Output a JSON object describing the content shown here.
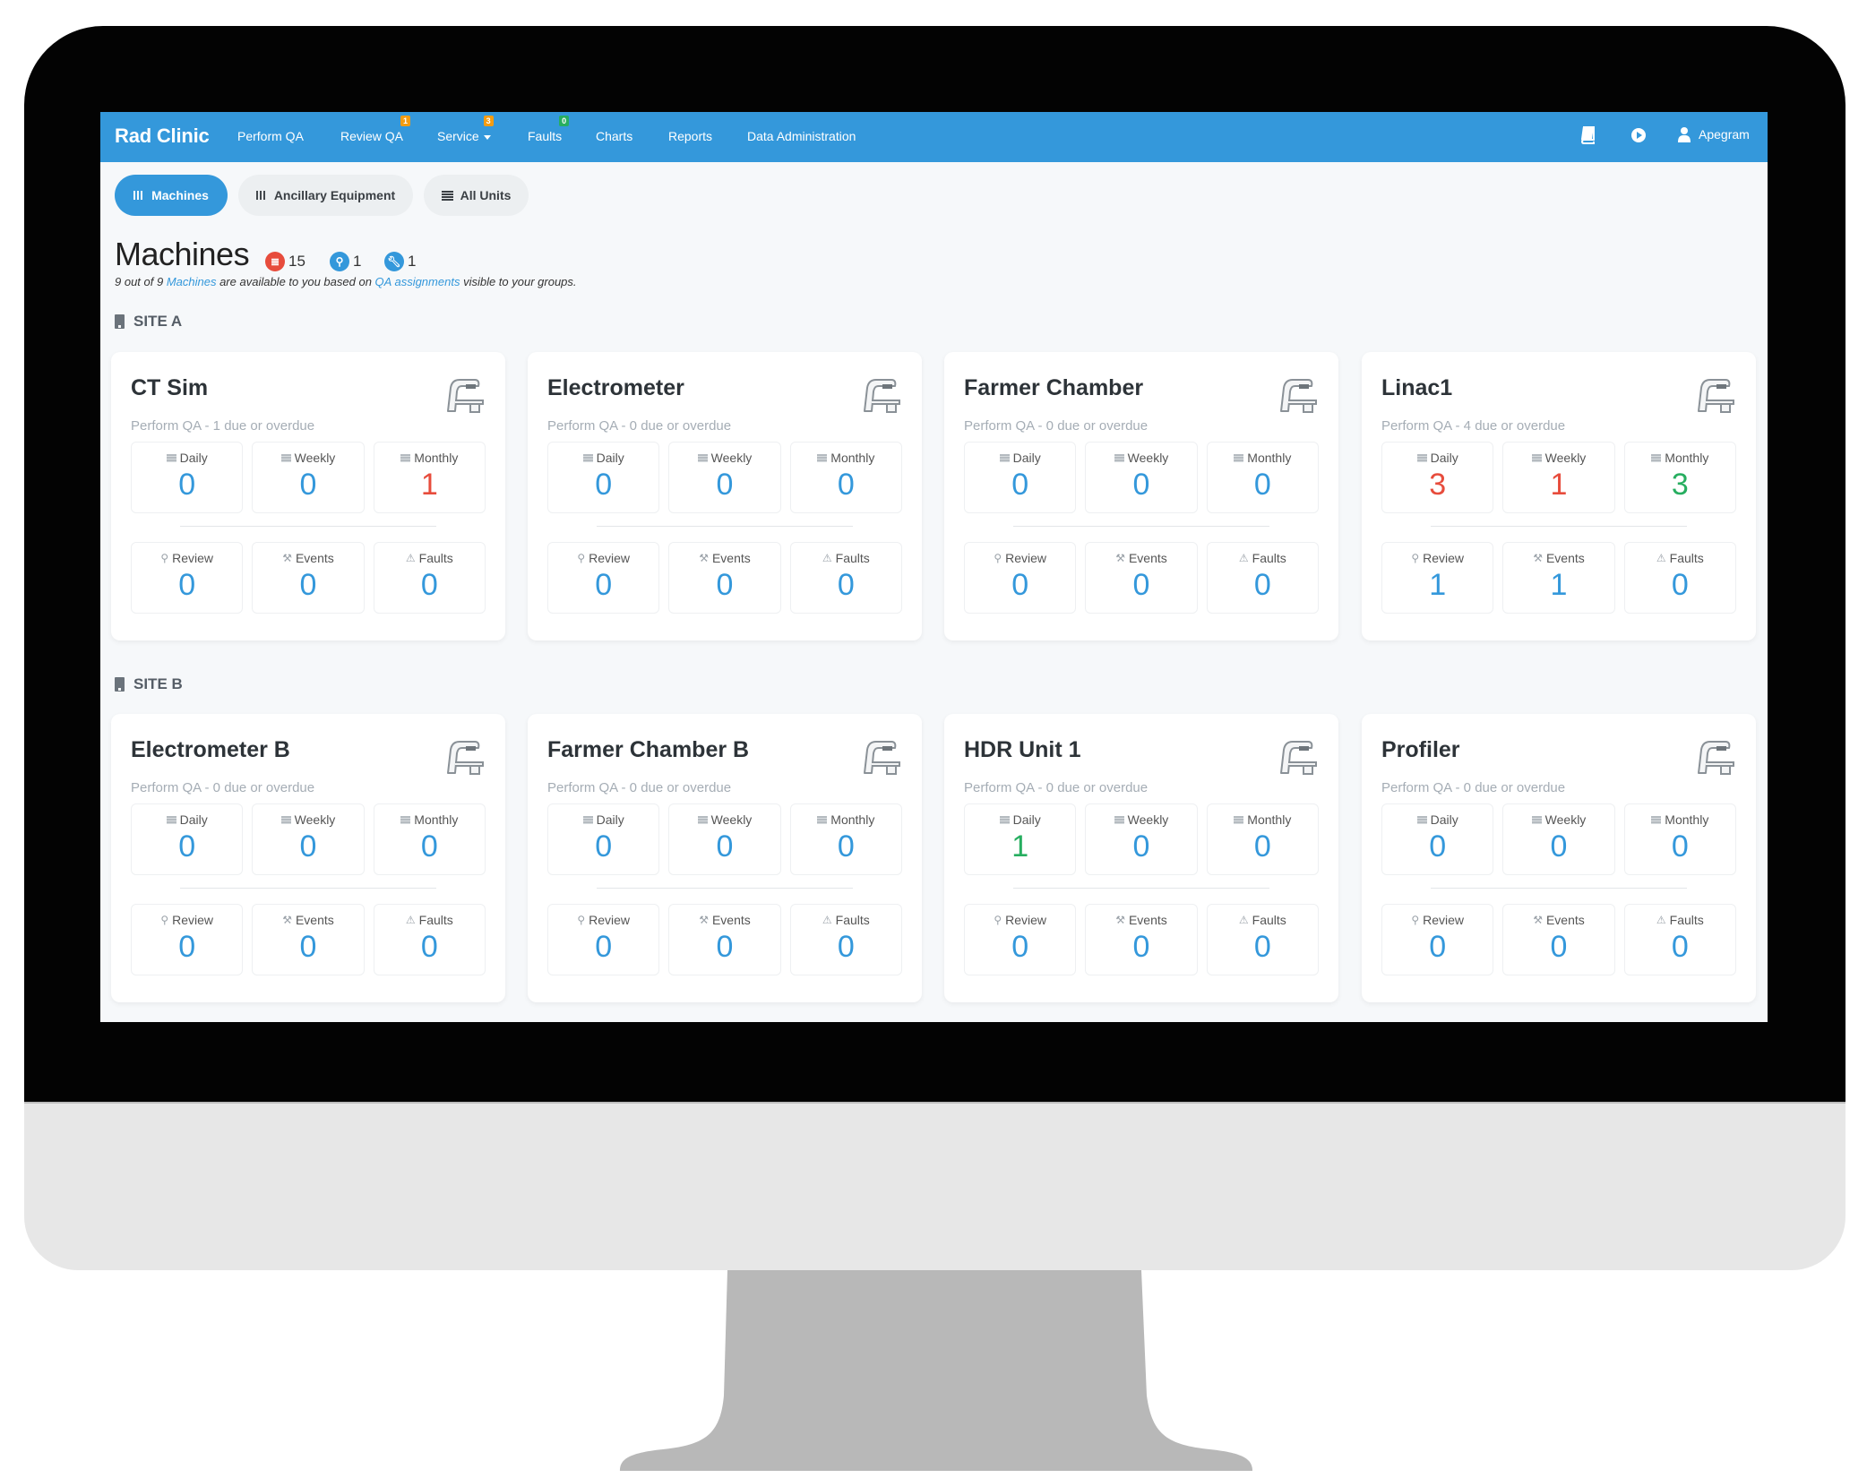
{
  "colors": {
    "primary": "#3498db",
    "danger": "#e74c3c",
    "success": "#27ae60",
    "warning": "#f39c12",
    "badge_green": "#2ecc71"
  },
  "navbar": {
    "brand": "Rad Clinic",
    "items": [
      {
        "label": "Perform QA"
      },
      {
        "label": "Review QA",
        "badge": "1",
        "badge_color": "warning"
      },
      {
        "label": "Service",
        "badge": "3",
        "badge_color": "warning",
        "dropdown": true
      },
      {
        "label": "Faults",
        "badge": "0",
        "badge_color": "success"
      },
      {
        "label": "Charts"
      },
      {
        "label": "Reports"
      },
      {
        "label": "Data Administration"
      }
    ],
    "right": {
      "book_icon": "book-icon",
      "play_icon": "play-circle-icon",
      "user_icon": "user-icon",
      "username": "Apegram"
    }
  },
  "tabs": [
    {
      "label": "Machines",
      "icon": "grid-icon",
      "active": true
    },
    {
      "label": "Ancillary Equipment",
      "icon": "grid-icon",
      "active": false
    },
    {
      "label": "All Units",
      "icon": "list-icon",
      "active": false
    }
  ],
  "header": {
    "title": "Machines",
    "counts": [
      {
        "icon": "qa-list-icon",
        "value": "15",
        "color": "danger"
      },
      {
        "icon": "search-icon",
        "value": "1",
        "color": "primary"
      },
      {
        "icon": "wrench-icon",
        "value": "1",
        "color": "primary"
      }
    ],
    "subtitle": {
      "prefix": "9 out of 9 ",
      "link1": "Machines",
      "middle": " are available to you based on ",
      "link2": "QA assignments",
      "suffix": " visible to your groups."
    }
  },
  "sites": [
    {
      "name": "SITE A",
      "machines": [
        {
          "name": "CT Sim",
          "summary": "Perform QA - 1 due or overdue",
          "qa": [
            {
              "label": "Daily",
              "value": "0",
              "status": "ok"
            },
            {
              "label": "Weekly",
              "value": "0",
              "status": "ok"
            },
            {
              "label": "Monthly",
              "value": "1",
              "status": "overdue"
            }
          ],
          "other": [
            {
              "label": "Review",
              "value": "0"
            },
            {
              "label": "Events",
              "value": "0"
            },
            {
              "label": "Faults",
              "value": "0"
            }
          ]
        },
        {
          "name": "Electrometer",
          "summary": "Perform QA - 0 due or overdue",
          "qa": [
            {
              "label": "Daily",
              "value": "0",
              "status": "ok"
            },
            {
              "label": "Weekly",
              "value": "0",
              "status": "ok"
            },
            {
              "label": "Monthly",
              "value": "0",
              "status": "ok"
            }
          ],
          "other": [
            {
              "label": "Review",
              "value": "0"
            },
            {
              "label": "Events",
              "value": "0"
            },
            {
              "label": "Faults",
              "value": "0"
            }
          ]
        },
        {
          "name": "Farmer Chamber",
          "summary": "Perform QA - 0 due or overdue",
          "qa": [
            {
              "label": "Daily",
              "value": "0",
              "status": "ok"
            },
            {
              "label": "Weekly",
              "value": "0",
              "status": "ok"
            },
            {
              "label": "Monthly",
              "value": "0",
              "status": "ok"
            }
          ],
          "other": [
            {
              "label": "Review",
              "value": "0"
            },
            {
              "label": "Events",
              "value": "0"
            },
            {
              "label": "Faults",
              "value": "0"
            }
          ]
        },
        {
          "name": "Linac1",
          "summary": "Perform QA - 4 due or overdue",
          "qa": [
            {
              "label": "Daily",
              "value": "3",
              "status": "overdue"
            },
            {
              "label": "Weekly",
              "value": "1",
              "status": "overdue"
            },
            {
              "label": "Monthly",
              "value": "3",
              "status": "due"
            }
          ],
          "other": [
            {
              "label": "Review",
              "value": "1"
            },
            {
              "label": "Events",
              "value": "1"
            },
            {
              "label": "Faults",
              "value": "0"
            }
          ]
        }
      ]
    },
    {
      "name": "SITE B",
      "machines": [
        {
          "name": "Electrometer B",
          "summary": "Perform QA - 0 due or overdue",
          "qa": [
            {
              "label": "Daily",
              "value": "0",
              "status": "ok"
            },
            {
              "label": "Weekly",
              "value": "0",
              "status": "ok"
            },
            {
              "label": "Monthly",
              "value": "0",
              "status": "ok"
            }
          ],
          "other": [
            {
              "label": "Review",
              "value": "0"
            },
            {
              "label": "Events",
              "value": "0"
            },
            {
              "label": "Faults",
              "value": "0"
            }
          ]
        },
        {
          "name": "Farmer Chamber B",
          "summary": "Perform QA - 0 due or overdue",
          "qa": [
            {
              "label": "Daily",
              "value": "0",
              "status": "ok"
            },
            {
              "label": "Weekly",
              "value": "0",
              "status": "ok"
            },
            {
              "label": "Monthly",
              "value": "0",
              "status": "ok"
            }
          ],
          "other": [
            {
              "label": "Review",
              "value": "0"
            },
            {
              "label": "Events",
              "value": "0"
            },
            {
              "label": "Faults",
              "value": "0"
            }
          ]
        },
        {
          "name": "HDR Unit 1",
          "summary": "Perform QA - 0 due or overdue",
          "qa": [
            {
              "label": "Daily",
              "value": "1",
              "status": "due"
            },
            {
              "label": "Weekly",
              "value": "0",
              "status": "ok"
            },
            {
              "label": "Monthly",
              "value": "0",
              "status": "ok"
            }
          ],
          "other": [
            {
              "label": "Review",
              "value": "0"
            },
            {
              "label": "Events",
              "value": "0"
            },
            {
              "label": "Faults",
              "value": "0"
            }
          ]
        },
        {
          "name": "Profiler",
          "summary": "Perform QA - 0 due or overdue",
          "qa": [
            {
              "label": "Daily",
              "value": "0",
              "status": "ok"
            },
            {
              "label": "Weekly",
              "value": "0",
              "status": "ok"
            },
            {
              "label": "Monthly",
              "value": "0",
              "status": "ok"
            }
          ],
          "other": [
            {
              "label": "Review",
              "value": "0"
            },
            {
              "label": "Events",
              "value": "0"
            },
            {
              "label": "Faults",
              "value": "0"
            }
          ]
        }
      ]
    }
  ]
}
